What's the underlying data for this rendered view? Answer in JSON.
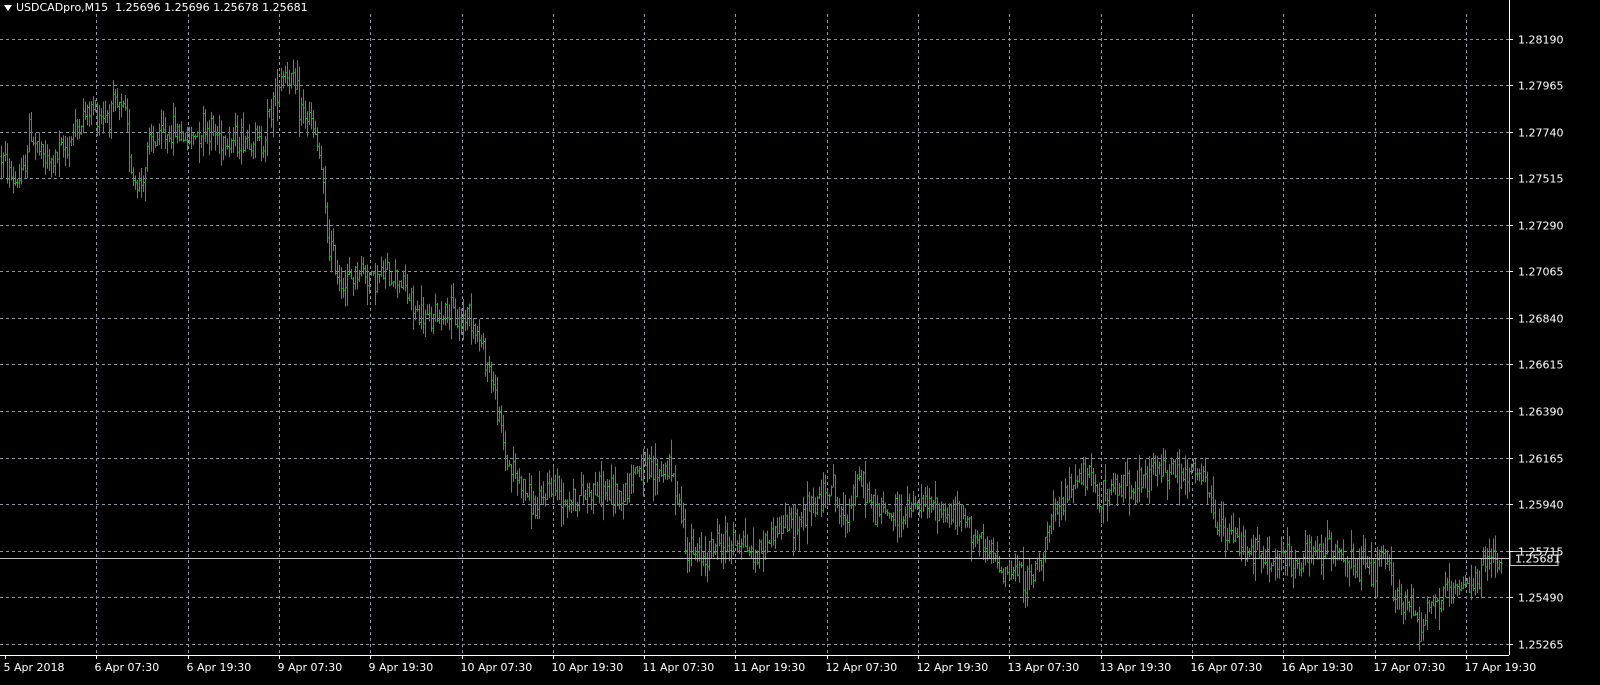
{
  "header": {
    "symbol": "USDCADpro,M15",
    "open": "1.25696",
    "high": "1.25696",
    "low": "1.25678",
    "close": "1.25681"
  },
  "colors": {
    "background": "#000000",
    "candle": "#00c800",
    "grid": "#8c96a0",
    "axis": "#ffffff",
    "price_line": "#c0c0c0"
  },
  "chart_data": {
    "type": "candlestick-bar",
    "grid": true,
    "current_price": 1.25681,
    "current_price_label": "1.25681",
    "y_ticks": [
      "1.28190",
      "1.27965",
      "1.27740",
      "1.27515",
      "1.27290",
      "1.27065",
      "1.26840",
      "1.26615",
      "1.26390",
      "1.26165",
      "1.25940",
      "1.25715",
      "1.25490",
      "1.25265"
    ],
    "ylim": [
      1.2521,
      1.2831
    ],
    "x_ticks": [
      "5 Apr 2018",
      "6 Apr 07:30",
      "6 Apr 19:30",
      "9 Apr 07:30",
      "9 Apr 19:30",
      "10 Apr 07:30",
      "10 Apr 19:30",
      "11 Apr 07:30",
      "11 Apr 19:30",
      "12 Apr 07:30",
      "12 Apr 19:30",
      "13 Apr 07:30",
      "13 Apr 19:30",
      "16 Apr 07:30",
      "16 Apr 19:30",
      "17 Apr 07:30",
      "17 Apr 19:30"
    ],
    "price_path": [
      [
        0.0,
        1.2762
      ],
      [
        0.008,
        1.275
      ],
      [
        0.014,
        1.2752
      ],
      [
        0.018,
        1.2775
      ],
      [
        0.026,
        1.2762
      ],
      [
        0.032,
        1.2758
      ],
      [
        0.04,
        1.2765
      ],
      [
        0.05,
        1.2778
      ],
      [
        0.058,
        1.2785
      ],
      [
        0.066,
        1.2783
      ],
      [
        0.074,
        1.2785
      ],
      [
        0.08,
        1.2782
      ],
      [
        0.085,
        1.2752
      ],
      [
        0.09,
        1.2748
      ],
      [
        0.096,
        1.2768
      ],
      [
        0.104,
        1.2772
      ],
      [
        0.112,
        1.2775
      ],
      [
        0.122,
        1.277
      ],
      [
        0.13,
        1.2778
      ],
      [
        0.138,
        1.2773
      ],
      [
        0.15,
        1.277
      ],
      [
        0.16,
        1.2772
      ],
      [
        0.168,
        1.2768
      ],
      [
        0.175,
        1.2788
      ],
      [
        0.182,
        1.2805
      ],
      [
        0.187,
        1.28
      ],
      [
        0.193,
        1.2785
      ],
      [
        0.2,
        1.2778
      ],
      [
        0.206,
        1.276
      ],
      [
        0.21,
        1.2725
      ],
      [
        0.216,
        1.2708
      ],
      [
        0.222,
        1.27
      ],
      [
        0.232,
        1.2708
      ],
      [
        0.24,
        1.2703
      ],
      [
        0.25,
        1.2705
      ],
      [
        0.258,
        1.2703
      ],
      [
        0.266,
        1.2688
      ],
      [
        0.276,
        1.2682
      ],
      [
        0.286,
        1.2688
      ],
      [
        0.296,
        1.2682
      ],
      [
        0.302,
        1.2688
      ],
      [
        0.31,
        1.267
      ],
      [
        0.316,
        1.2658
      ],
      [
        0.32,
        1.264
      ],
      [
        0.326,
        1.2615
      ],
      [
        0.332,
        1.2608
      ],
      [
        0.34,
        1.2598
      ],
      [
        0.346,
        1.259
      ],
      [
        0.354,
        1.2605
      ],
      [
        0.364,
        1.2598
      ],
      [
        0.372,
        1.2596
      ],
      [
        0.38,
        1.2602
      ],
      [
        0.39,
        1.26
      ],
      [
        0.4,
        1.2598
      ],
      [
        0.41,
        1.2612
      ],
      [
        0.42,
        1.2608
      ],
      [
        0.43,
        1.2612
      ],
      [
        0.436,
        1.2602
      ],
      [
        0.442,
        1.2575
      ],
      [
        0.448,
        1.2568
      ],
      [
        0.454,
        1.257
      ],
      [
        0.462,
        1.2575
      ],
      [
        0.47,
        1.2575
      ],
      [
        0.478,
        1.2578
      ],
      [
        0.486,
        1.2568
      ],
      [
        0.492,
        1.2575
      ],
      [
        0.5,
        1.2582
      ],
      [
        0.51,
        1.2585
      ],
      [
        0.52,
        1.259
      ],
      [
        0.53,
        1.2598
      ],
      [
        0.536,
        1.2605
      ],
      [
        0.542,
        1.2585
      ],
      [
        0.55,
        1.26
      ],
      [
        0.556,
        1.2605
      ],
      [
        0.562,
        1.2592
      ],
      [
        0.57,
        1.259
      ],
      [
        0.58,
        1.2588
      ],
      [
        0.59,
        1.2592
      ],
      [
        0.6,
        1.2593
      ],
      [
        0.61,
        1.259
      ],
      [
        0.618,
        1.2588
      ],
      [
        0.626,
        1.2583
      ],
      [
        0.634,
        1.257
      ],
      [
        0.642,
        1.2568
      ],
      [
        0.65,
        1.256
      ],
      [
        0.658,
        1.2562
      ],
      [
        0.664,
        1.2555
      ],
      [
        0.67,
        1.2568
      ],
      [
        0.678,
        1.2585
      ],
      [
        0.686,
        1.2595
      ],
      [
        0.694,
        1.2608
      ],
      [
        0.702,
        1.2605
      ],
      [
        0.71,
        1.2598
      ],
      [
        0.718,
        1.26
      ],
      [
        0.726,
        1.2605
      ],
      [
        0.734,
        1.2602
      ],
      [
        0.742,
        1.2608
      ],
      [
        0.75,
        1.2612
      ],
      [
        0.756,
        1.2612
      ],
      [
        0.762,
        1.2605
      ],
      [
        0.77,
        1.261
      ],
      [
        0.776,
        1.2605
      ],
      [
        0.782,
        1.259
      ],
      [
        0.788,
        1.258
      ],
      [
        0.796,
        1.2578
      ],
      [
        0.804,
        1.2574
      ],
      [
        0.812,
        1.2568
      ],
      [
        0.82,
        1.2565
      ],
      [
        0.828,
        1.2568
      ],
      [
        0.836,
        1.2564
      ],
      [
        0.844,
        1.2568
      ],
      [
        0.852,
        1.2572
      ],
      [
        0.86,
        1.2573
      ],
      [
        0.868,
        1.257
      ],
      [
        0.874,
        1.256
      ],
      [
        0.88,
        1.2565
      ],
      [
        0.886,
        1.256
      ],
      [
        0.892,
        1.2568
      ],
      [
        0.898,
        1.2555
      ],
      [
        0.904,
        1.2545
      ],
      [
        0.91,
        1.2545
      ],
      [
        0.916,
        1.2535
      ],
      [
        0.92,
        1.2543
      ],
      [
        0.928,
        1.2548
      ],
      [
        0.936,
        1.255
      ],
      [
        0.944,
        1.2552
      ],
      [
        0.952,
        1.2558
      ],
      [
        0.958,
        1.2565
      ],
      [
        0.964,
        1.257
      ],
      [
        0.968,
        1.2568
      ]
    ]
  }
}
